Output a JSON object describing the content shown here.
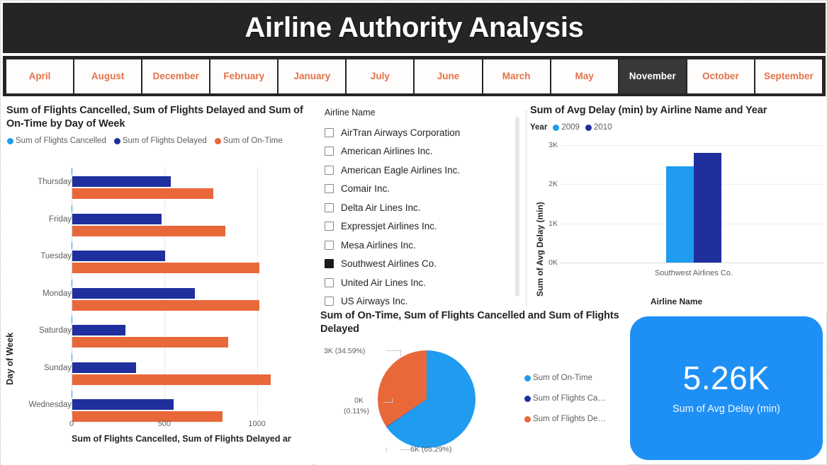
{
  "header": {
    "title": "Airline Authority Analysis"
  },
  "month_tabs": {
    "selected": "November",
    "items": [
      {
        "label": "April"
      },
      {
        "label": "August"
      },
      {
        "label": "December"
      },
      {
        "label": "February"
      },
      {
        "label": "January"
      },
      {
        "label": "July"
      },
      {
        "label": "June"
      },
      {
        "label": "March"
      },
      {
        "label": "May"
      },
      {
        "label": "November"
      },
      {
        "label": "October"
      },
      {
        "label": "September"
      }
    ]
  },
  "slicer": {
    "header": "Airline Name",
    "items": [
      {
        "label": "AirTran Airways Corporation",
        "checked": false
      },
      {
        "label": "American Airlines Inc.",
        "checked": false
      },
      {
        "label": "American Eagle Airlines Inc.",
        "checked": false
      },
      {
        "label": "Comair Inc.",
        "checked": false
      },
      {
        "label": "Delta Air Lines Inc.",
        "checked": false
      },
      {
        "label": "Expressjet Airlines Inc.",
        "checked": false
      },
      {
        "label": "Mesa Airlines Inc.",
        "checked": false
      },
      {
        "label": "Southwest Airlines Co.",
        "checked": true
      },
      {
        "label": "United Air Lines Inc.",
        "checked": false
      },
      {
        "label": "US Airways Inc.",
        "checked": false
      }
    ]
  },
  "kpi": {
    "value": "5.26K",
    "label": "Sum of Avg Delay (min)",
    "color": "#1e90f5"
  },
  "chart_data": [
    {
      "id": "bar",
      "type": "bar",
      "orientation": "horizontal",
      "title": "Sum of Flights Cancelled, Sum of Flights Delayed and Sum of On-Time by Day of Week",
      "xlabel": "Sum of Flights Cancelled, Sum of Flights Delayed and S…",
      "ylabel": "Day of Week",
      "categories": [
        "Thursday",
        "Friday",
        "Tuesday",
        "Monday",
        "Saturday",
        "Sunday",
        "Wednesday"
      ],
      "xlim": [
        0,
        1070
      ],
      "xticks": [
        0,
        500,
        1000
      ],
      "grid": true,
      "legend_position": "top",
      "series": [
        {
          "name": "Sum of Flights Cancelled",
          "color": "#1f9bf0",
          "values": [
            3,
            2,
            2,
            3,
            2,
            2,
            3
          ]
        },
        {
          "name": "Sum of Flights Delayed",
          "color": "#1f2f9e",
          "values": [
            530,
            480,
            500,
            660,
            285,
            345,
            545
          ]
        },
        {
          "name": "Sum of On-Time",
          "color": "#e8683a",
          "values": [
            760,
            825,
            1010,
            1010,
            840,
            1070,
            810
          ]
        }
      ]
    },
    {
      "id": "column",
      "type": "bar",
      "orientation": "vertical",
      "title": "Sum of Avg Delay (min) by Airline Name and Year",
      "xlabel": "Airline Name",
      "ylabel": "Sum of Avg Delay (min)",
      "legend_title": "Year",
      "legend_position": "top",
      "categories": [
        "Southwest Airlines Co."
      ],
      "ylim": [
        0,
        3000
      ],
      "yticks": [
        "0K",
        "1K",
        "2K",
        "3K"
      ],
      "grid": true,
      "series": [
        {
          "name": "2009",
          "color": "#1f9bf0",
          "values": [
            2450
          ]
        },
        {
          "name": "2010",
          "color": "#1f2f9e",
          "values": [
            2810
          ]
        }
      ]
    },
    {
      "id": "pie",
      "type": "pie",
      "title": "Sum of On-Time, Sum of Flights Cancelled and Sum of Flights Delayed",
      "legend_position": "right",
      "slices": [
        {
          "name": "Sum of On-Time",
          "legend_label": "Sum of On-Time",
          "color": "#1f9bf0",
          "percent": 65.29,
          "label": "6K (65.29%)"
        },
        {
          "name": "Sum of Flights Cancelled",
          "legend_label": "Sum of Flights Ca…",
          "color": "#1f2f9e",
          "percent": 0.11,
          "label": "0K (0.11%)"
        },
        {
          "name": "Sum of Flights Delayed",
          "legend_label": "Sum of Flights De…",
          "color": "#e8683a",
          "percent": 34.59,
          "label": "3K (34.59%)"
        }
      ]
    }
  ]
}
